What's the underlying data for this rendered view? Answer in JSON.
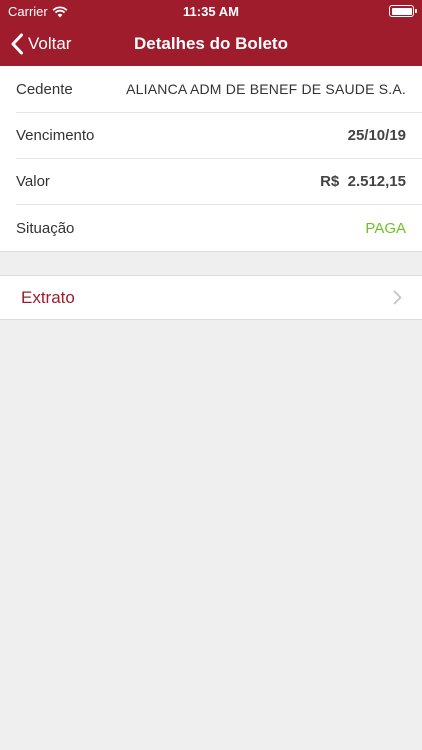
{
  "status_bar": {
    "carrier": "Carrier",
    "time": "11:35 AM"
  },
  "nav": {
    "back_label": "Voltar",
    "title": "Detalhes do Boleto"
  },
  "details": [
    {
      "label": "Cedente",
      "value": "ALIANCA ADM DE BENEF DE SAUDE S.A."
    },
    {
      "label": "Vencimento",
      "value": "25/10/19"
    },
    {
      "label": "Valor",
      "value": "R$  2.512,15"
    },
    {
      "label": "Situação",
      "value": "PAGA"
    }
  ],
  "extrato": {
    "label": "Extrato"
  },
  "colors": {
    "brand": "#9e1c2b",
    "status_paid": "#6ec227",
    "background": "#efefef"
  },
  "icons": {
    "wifi": "wifi-icon",
    "battery": "battery-icon",
    "back": "chevron-left-icon",
    "extrato": "chevron-right-icon"
  }
}
